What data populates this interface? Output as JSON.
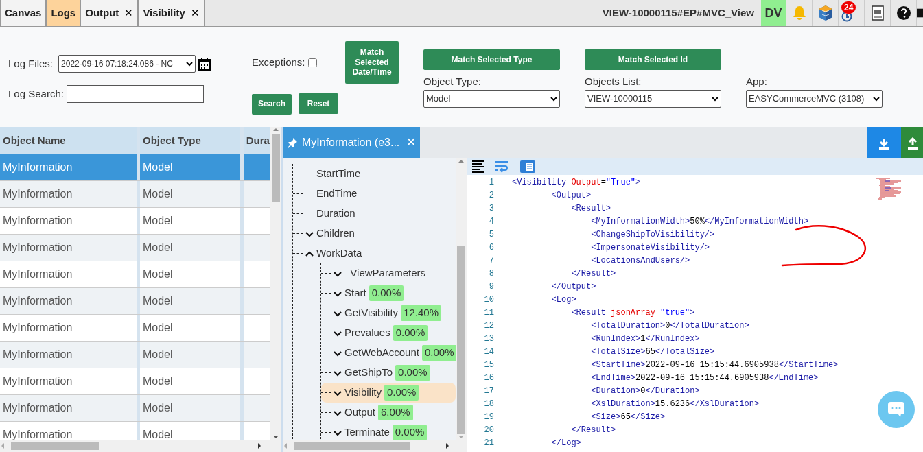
{
  "tabs": [
    {
      "label": "Canvas",
      "selected": false
    },
    {
      "label": "Logs",
      "selected": true
    },
    {
      "label": "Output",
      "selected": false,
      "close": "✕"
    },
    {
      "label": "Visibility",
      "selected": false,
      "close": "✕"
    }
  ],
  "view_title": "VIEW-10000115#EP#MVC_View",
  "user_badge": "DV",
  "notification_count": "24",
  "toolbar": {
    "log_files_label": "Log Files:",
    "log_files_value": "2022-09-16 07:18:24.086 - NC",
    "exceptions_label": "Exceptions:",
    "exceptions_checked": false,
    "match_datetime": "Match Selected Date/Time",
    "match_type": "Match Selected Type",
    "match_id": "Match Selected Id",
    "object_type_label": "Object Type:",
    "object_type_value": "Model",
    "objects_list_label": "Objects List:",
    "objects_list_value": "VIEW-10000115",
    "app_label": "App:",
    "app_value": "EASYCommerceMVC (3108)",
    "log_search_label": "Log Search:",
    "search_button": "Search",
    "reset_button": "Reset"
  },
  "table": {
    "columns": [
      "Object Name",
      "Object Type",
      "Dura"
    ],
    "rows": [
      {
        "name": "MyInformation",
        "type": "Model",
        "selected": true
      },
      {
        "name": "MyInformation",
        "type": "Model",
        "selected": false
      },
      {
        "name": "MyInformation",
        "type": "Model",
        "selected": false
      },
      {
        "name": "MyInformation",
        "type": "Model",
        "selected": false
      },
      {
        "name": "MyInformation",
        "type": "Model",
        "selected": false
      },
      {
        "name": "MyInformation",
        "type": "Model",
        "selected": false
      },
      {
        "name": "MyInformation",
        "type": "Model",
        "selected": false
      },
      {
        "name": "MyInformation",
        "type": "Model",
        "selected": false
      },
      {
        "name": "MyInformation",
        "type": "Model",
        "selected": false
      },
      {
        "name": "MyInformation",
        "type": "Model",
        "selected": false
      },
      {
        "name": "MyInformation",
        "type": "Model",
        "selected": false
      }
    ]
  },
  "detail_tab": {
    "label": "MyInformation (e3...",
    "close": "✕"
  },
  "tree": [
    {
      "label": "StartTime"
    },
    {
      "label": "EndTime"
    },
    {
      "label": "Duration"
    },
    {
      "label": "Children",
      "expanded": false
    },
    {
      "label": "WorkData",
      "expanded": true,
      "children": [
        {
          "label": "_ViewParameters",
          "expanded": false,
          "selected": false
        },
        {
          "label": "Start",
          "percent": "0.00%",
          "expanded": false,
          "selected": false
        },
        {
          "label": "GetVisibility",
          "percent": "12.40%",
          "expanded": false,
          "selected": false
        },
        {
          "label": "Prevalues",
          "percent": "0.00%",
          "expanded": false,
          "selected": false
        },
        {
          "label": "GetWebAccount",
          "percent": "0.00%",
          "expanded": false,
          "selected": false
        },
        {
          "label": "GetShipTo",
          "percent": "0.00%",
          "expanded": false,
          "selected": false
        },
        {
          "label": "Visibility",
          "percent": "0.00%",
          "expanded": false,
          "selected": true
        },
        {
          "label": "Output",
          "percent": "6.00%",
          "expanded": false,
          "selected": false
        },
        {
          "label": "Terminate",
          "percent": "0.00%",
          "expanded": false,
          "selected": false
        }
      ]
    }
  ],
  "code": [
    {
      "number": "1",
      "tokens": [
        {
          "kind": "tag",
          "text": "<Visibility "
        },
        {
          "kind": "attr",
          "text": "Output"
        },
        {
          "kind": "text",
          "text": "="
        },
        {
          "kind": "val",
          "text": "\"True\""
        },
        {
          "kind": "tag",
          "text": ">"
        }
      ]
    },
    {
      "number": "2",
      "tokens": [
        {
          "kind": "tag",
          "text": "        <Output>"
        }
      ]
    },
    {
      "number": "3",
      "tokens": [
        {
          "kind": "tag",
          "text": "            <Result>"
        }
      ]
    },
    {
      "number": "4",
      "tokens": [
        {
          "kind": "tag",
          "text": "                <MyInformationWidth>"
        },
        {
          "kind": "text",
          "text": "50%"
        },
        {
          "kind": "tag",
          "text": "</MyInformationWidth>"
        }
      ]
    },
    {
      "number": "5",
      "tokens": [
        {
          "kind": "tag",
          "text": "                <ChangeShipToVisibility/>"
        }
      ]
    },
    {
      "number": "6",
      "tokens": [
        {
          "kind": "tag",
          "text": "                <ImpersonateVisibility/>"
        }
      ]
    },
    {
      "number": "7",
      "tokens": [
        {
          "kind": "tag",
          "text": "                <LocationsAndUsers/>"
        }
      ]
    },
    {
      "number": "8",
      "tokens": [
        {
          "kind": "tag",
          "text": "            </Result>"
        }
      ]
    },
    {
      "number": "9",
      "tokens": [
        {
          "kind": "tag",
          "text": "        </Output>"
        }
      ]
    },
    {
      "number": "10",
      "tokens": [
        {
          "kind": "tag",
          "text": "        <Log>"
        }
      ]
    },
    {
      "number": "11",
      "tokens": [
        {
          "kind": "tag",
          "text": "            <Result "
        },
        {
          "kind": "attr",
          "text": "jsonArray"
        },
        {
          "kind": "text",
          "text": "="
        },
        {
          "kind": "val",
          "text": "\"true\""
        },
        {
          "kind": "tag",
          "text": ">"
        }
      ]
    },
    {
      "number": "12",
      "tokens": [
        {
          "kind": "tag",
          "text": "                <TotalDuration>"
        },
        {
          "kind": "text",
          "text": "0"
        },
        {
          "kind": "tag",
          "text": "</TotalDuration>"
        }
      ]
    },
    {
      "number": "13",
      "tokens": [
        {
          "kind": "tag",
          "text": "                <RunIndex>"
        },
        {
          "kind": "text",
          "text": "1"
        },
        {
          "kind": "tag",
          "text": "</RunIndex>"
        }
      ]
    },
    {
      "number": "14",
      "tokens": [
        {
          "kind": "tag",
          "text": "                <TotalSize>"
        },
        {
          "kind": "text",
          "text": "65"
        },
        {
          "kind": "tag",
          "text": "</TotalSize>"
        }
      ]
    },
    {
      "number": "15",
      "tokens": [
        {
          "kind": "tag",
          "text": "                <StartTime>"
        },
        {
          "kind": "text",
          "text": "2022-09-16 15:15:44.6905938"
        },
        {
          "kind": "tag",
          "text": "</StartTime>"
        }
      ]
    },
    {
      "number": "16",
      "tokens": [
        {
          "kind": "tag",
          "text": "                <EndTime>"
        },
        {
          "kind": "text",
          "text": "2022-09-16 15:15:44.6905938"
        },
        {
          "kind": "tag",
          "text": "</EndTime>"
        }
      ]
    },
    {
      "number": "17",
      "tokens": [
        {
          "kind": "tag",
          "text": "                <Duration>"
        },
        {
          "kind": "text",
          "text": "0"
        },
        {
          "kind": "tag",
          "text": "</Duration>"
        }
      ]
    },
    {
      "number": "18",
      "tokens": [
        {
          "kind": "tag",
          "text": "                <XslDuration>"
        },
        {
          "kind": "text",
          "text": "15.6236"
        },
        {
          "kind": "tag",
          "text": "</XslDuration>"
        }
      ]
    },
    {
      "number": "19",
      "tokens": [
        {
          "kind": "tag",
          "text": "                <Size>"
        },
        {
          "kind": "text",
          "text": "65"
        },
        {
          "kind": "tag",
          "text": "</Size>"
        }
      ]
    },
    {
      "number": "20",
      "tokens": [
        {
          "kind": "tag",
          "text": "            </Result>"
        }
      ]
    },
    {
      "number": "21",
      "tokens": [
        {
          "kind": "tag",
          "text": "        </Log>"
        }
      ]
    }
  ]
}
